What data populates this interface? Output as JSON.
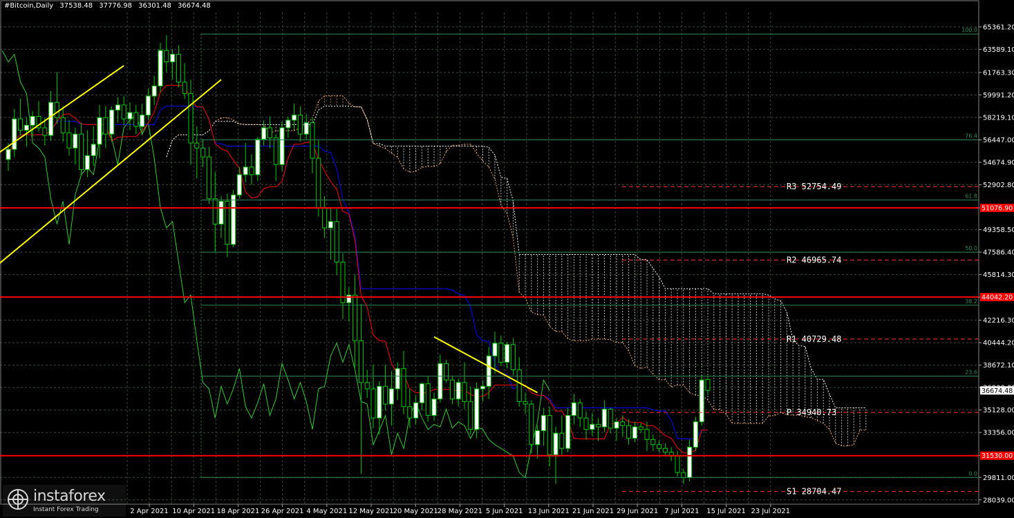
{
  "header": {
    "symbol": "#Bitcoin,Daily",
    "open": "37538.48",
    "high": "37776.98",
    "low": "36301.48",
    "close": "36674.48"
  },
  "logo": {
    "name": "instaforex",
    "tagline": "Instant Forex Trading",
    "icon": "instaforex-logo-icon"
  },
  "colors": {
    "background": "#000000",
    "grid": "#3a4a3a",
    "bull_candle": "#ffffff",
    "bear_candle": "#000000",
    "candle_wick": "#00cc00",
    "tenkan": "#ff0000",
    "kijun": "#0000ff",
    "chikou": "#32cd32",
    "cloud_bull": "#f4a460",
    "cloud_bear": "#ffffff",
    "trendline": "#ffff00",
    "fib": "#2e8b57",
    "pivot": "#ff3333",
    "sr_line": "#ff0000"
  },
  "chart_data": {
    "type": "candlestick",
    "title": "#Bitcoin,Daily",
    "x_ticks": [
      "2 Apr 2021",
      "10 Apr 2021",
      "18 Apr 2021",
      "26 Apr 2021",
      "4 May 2021",
      "12 May 2021",
      "20 May 2021",
      "28 May 2021",
      "5 Jun 2021",
      "13 Jun 2021",
      "21 Jun 2021",
      "29 Jun 2021",
      "7 Jul 2021",
      "15 Jul 2021",
      "23 Jul 2021"
    ],
    "y_ticks": [
      "65361.20",
      "63589.10",
      "61763.30",
      "59991.20",
      "58219.10",
      "56447.00",
      "54674.90",
      "52902.80",
      "51076.90",
      "49358.50",
      "47586.40",
      "45814.30",
      "44042.20",
      "42216.30",
      "40444.20",
      "38672.10",
      "36900.00",
      "35128.00",
      "33356.00",
      "31530.00",
      "29811.00",
      "28039.00"
    ],
    "ylim": [
      27700,
      66500
    ],
    "candles": [
      [
        54900,
        56200,
        54000,
        55700
      ],
      [
        55700,
        58900,
        55100,
        58100
      ],
      [
        58100,
        59700,
        56800,
        57200
      ],
      [
        57200,
        58200,
        55900,
        57600
      ],
      [
        57600,
        58700,
        56700,
        58300
      ],
      [
        58300,
        59500,
        57100,
        57400
      ],
      [
        57400,
        58200,
        56000,
        56800
      ],
      [
        56800,
        60300,
        56400,
        59400
      ],
      [
        59400,
        61800,
        57700,
        58200
      ],
      [
        58200,
        59100,
        56300,
        57000
      ],
      [
        57000,
        58000,
        55200,
        55800
      ],
      [
        55800,
        57400,
        54500,
        56900
      ],
      [
        56900,
        57800,
        53600,
        54100
      ],
      [
        54100,
        57200,
        53500,
        55200
      ],
      [
        55200,
        57500,
        54400,
        56100
      ],
      [
        56100,
        59200,
        55000,
        58200
      ],
      [
        58200,
        59100,
        55800,
        56900
      ],
      [
        56900,
        59100,
        56300,
        58800
      ],
      [
        58800,
        59800,
        57800,
        59200
      ],
      [
        59200,
        59900,
        57600,
        58100
      ],
      [
        58100,
        59400,
        57200,
        58600
      ],
      [
        58600,
        59200,
        56900,
        57500
      ],
      [
        57500,
        59300,
        56800,
        58400
      ],
      [
        58400,
        60500,
        58000,
        59900
      ],
      [
        59900,
        61500,
        59200,
        60700
      ],
      [
        60700,
        64100,
        60200,
        63500
      ],
      [
        63500,
        64700,
        61800,
        62600
      ],
      [
        62600,
        63600,
        61200,
        63200
      ],
      [
        63200,
        63900,
        60600,
        61000
      ],
      [
        61000,
        62500,
        59700,
        60100
      ],
      [
        60100,
        61200,
        54500,
        56200
      ],
      [
        56200,
        57500,
        53400,
        55800
      ],
      [
        55800,
        56500,
        54300,
        55100
      ],
      [
        55100,
        55900,
        51400,
        51800
      ],
      [
        51800,
        53900,
        47600,
        49800
      ],
      [
        49800,
        52000,
        48700,
        51600
      ],
      [
        51600,
        52200,
        47200,
        48200
      ],
      [
        48200,
        52500,
        48000,
        52100
      ],
      [
        52100,
        54300,
        51800,
        53700
      ],
      [
        53700,
        56200,
        53100,
        54300
      ],
      [
        54300,
        55300,
        52900,
        53700
      ],
      [
        53700,
        56700,
        53200,
        56500
      ],
      [
        56500,
        58000,
        56000,
        57400
      ],
      [
        57400,
        58300,
        55800,
        56600
      ],
      [
        56600,
        56900,
        53200,
        54500
      ],
      [
        54500,
        57900,
        54000,
        57400
      ],
      [
        57400,
        58300,
        56600,
        58000
      ],
      [
        58000,
        59300,
        57300,
        58400
      ],
      [
        58400,
        59100,
        56300,
        56900
      ],
      [
        56900,
        58500,
        56500,
        57800
      ],
      [
        57800,
        58200,
        53800,
        55000
      ],
      [
        55000,
        56400,
        50400,
        51100
      ],
      [
        51100,
        52000,
        48700,
        49500
      ],
      [
        49500,
        51100,
        47000,
        50000
      ],
      [
        50000,
        51000,
        45800,
        46800
      ],
      [
        46800,
        47500,
        42300,
        43600
      ],
      [
        43600,
        44800,
        42100,
        44200
      ],
      [
        44200,
        45800,
        38500,
        40600
      ],
      [
        40600,
        43500,
        30100,
        37300
      ],
      [
        37300,
        38300,
        36100,
        36800
      ],
      [
        36800,
        38700,
        33700,
        34500
      ],
      [
        34500,
        37400,
        33200,
        37000
      ],
      [
        37000,
        38700,
        35100,
        35600
      ],
      [
        35600,
        38200,
        33900,
        36800
      ],
      [
        36800,
        38900,
        35900,
        38400
      ],
      [
        38400,
        39800,
        34800,
        35400
      ],
      [
        35400,
        36800,
        33700,
        34500
      ],
      [
        34500,
        36300,
        34000,
        35700
      ],
      [
        35700,
        37300,
        35100,
        37200
      ],
      [
        37200,
        37800,
        34200,
        34700
      ],
      [
        34700,
        36500,
        34300,
        36000
      ],
      [
        36000,
        39500,
        35700,
        38800
      ],
      [
        38800,
        39100,
        37300,
        37500
      ],
      [
        37500,
        37800,
        35600,
        36000
      ],
      [
        36000,
        37600,
        35400,
        37300
      ],
      [
        37300,
        38900,
        35200,
        35800
      ],
      [
        35800,
        37000,
        33200,
        33600
      ],
      [
        33600,
        37300,
        32900,
        36800
      ],
      [
        36800,
        37500,
        35800,
        37000
      ],
      [
        37000,
        40100,
        36000,
        39400
      ],
      [
        39400,
        41300,
        38000,
        40400
      ],
      [
        40400,
        41000,
        38600,
        38900
      ],
      [
        38900,
        40500,
        38400,
        40300
      ],
      [
        40300,
        40800,
        37900,
        38300
      ],
      [
        38300,
        39300,
        35400,
        35800
      ],
      [
        35800,
        36500,
        34800,
        35600
      ],
      [
        35600,
        35900,
        31700,
        32400
      ],
      [
        32400,
        33900,
        31300,
        33500
      ],
      [
        33500,
        35300,
        32300,
        34700
      ],
      [
        34700,
        35400,
        30700,
        31600
      ],
      [
        31600,
        33800,
        29300,
        33300
      ],
      [
        33300,
        34700,
        31600,
        32100
      ],
      [
        32100,
        35300,
        31800,
        34700
      ],
      [
        34700,
        36400,
        34000,
        35700
      ],
      [
        35700,
        36000,
        33800,
        34500
      ],
      [
        34500,
        35000,
        32800,
        33600
      ],
      [
        33600,
        34900,
        33100,
        34000
      ],
      [
        34000,
        34500,
        32700,
        33800
      ],
      [
        33800,
        35900,
        33400,
        35200
      ],
      [
        35200,
        35300,
        33300,
        33700
      ],
      [
        33700,
        34500,
        32700,
        34200
      ],
      [
        34200,
        34700,
        33000,
        33900
      ],
      [
        33900,
        34400,
        32400,
        32900
      ],
      [
        32900,
        34200,
        32600,
        33800
      ],
      [
        33800,
        34100,
        33300,
        33600
      ],
      [
        33600,
        34200,
        31900,
        32800
      ],
      [
        32800,
        33200,
        31900,
        32400
      ],
      [
        32400,
        32700,
        31800,
        32100
      ],
      [
        32100,
        32500,
        31500,
        31800
      ],
      [
        31800,
        32200,
        31100,
        31500
      ],
      [
        31500,
        31900,
        29900,
        30200
      ],
      [
        30200,
        30500,
        29300,
        29800
      ],
      [
        29800,
        32800,
        29500,
        32200
      ],
      [
        32200,
        34600,
        31900,
        34200
      ],
      [
        34200,
        37800,
        33900,
        37500
      ],
      [
        37538.48,
        37776.98,
        36301.48,
        36674.48
      ]
    ],
    "price_labels": [
      {
        "price": 51076.9,
        "text": "51076.90",
        "kind": "sr"
      },
      {
        "price": 44042.2,
        "text": "44042.20",
        "kind": "sr"
      },
      {
        "price": 36674.48,
        "text": "36674.48",
        "kind": "last"
      },
      {
        "price": 31530.0,
        "text": "31530.00",
        "kind": "sr"
      }
    ],
    "sr_lines": [
      51076.9,
      44042.2,
      31530.0
    ],
    "fib_levels": [
      {
        "label": "100.0",
        "price": 64800
      },
      {
        "label": "76.4",
        "price": 56447
      },
      {
        "label": "61.8",
        "price": 51700
      },
      {
        "label": "50.0",
        "price": 47586
      },
      {
        "label": "38.2",
        "price": 43400
      },
      {
        "label": "23.6",
        "price": 37800
      },
      {
        "label": "0.0",
        "price": 29811
      }
    ],
    "pivots": [
      {
        "label": "R3",
        "value": "52754.49",
        "price": 52754.49
      },
      {
        "label": "R2",
        "value": "46965.74",
        "price": 46965.74
      },
      {
        "label": "R1",
        "value": "40729.48",
        "price": 40729.48
      },
      {
        "label": "P",
        "value": "34940.73",
        "price": 34940.73
      },
      {
        "label": "S1",
        "value": "28704.47",
        "price": 28704.47
      }
    ],
    "trendlines": [
      {
        "from": [
          -10,
          52600
        ],
        "to": [
          19,
          62300
        ]
      },
      {
        "from": [
          -9,
          43700
        ],
        "to": [
          35,
          61200
        ]
      },
      {
        "from": [
          70,
          40900
        ],
        "to": [
          87,
          36500
        ]
      }
    ],
    "indicator": "Ichimoku Kinko Hyo (Tenkan-sen, Kijun-sen, Senkou Span A/B, Chikou Span)"
  }
}
